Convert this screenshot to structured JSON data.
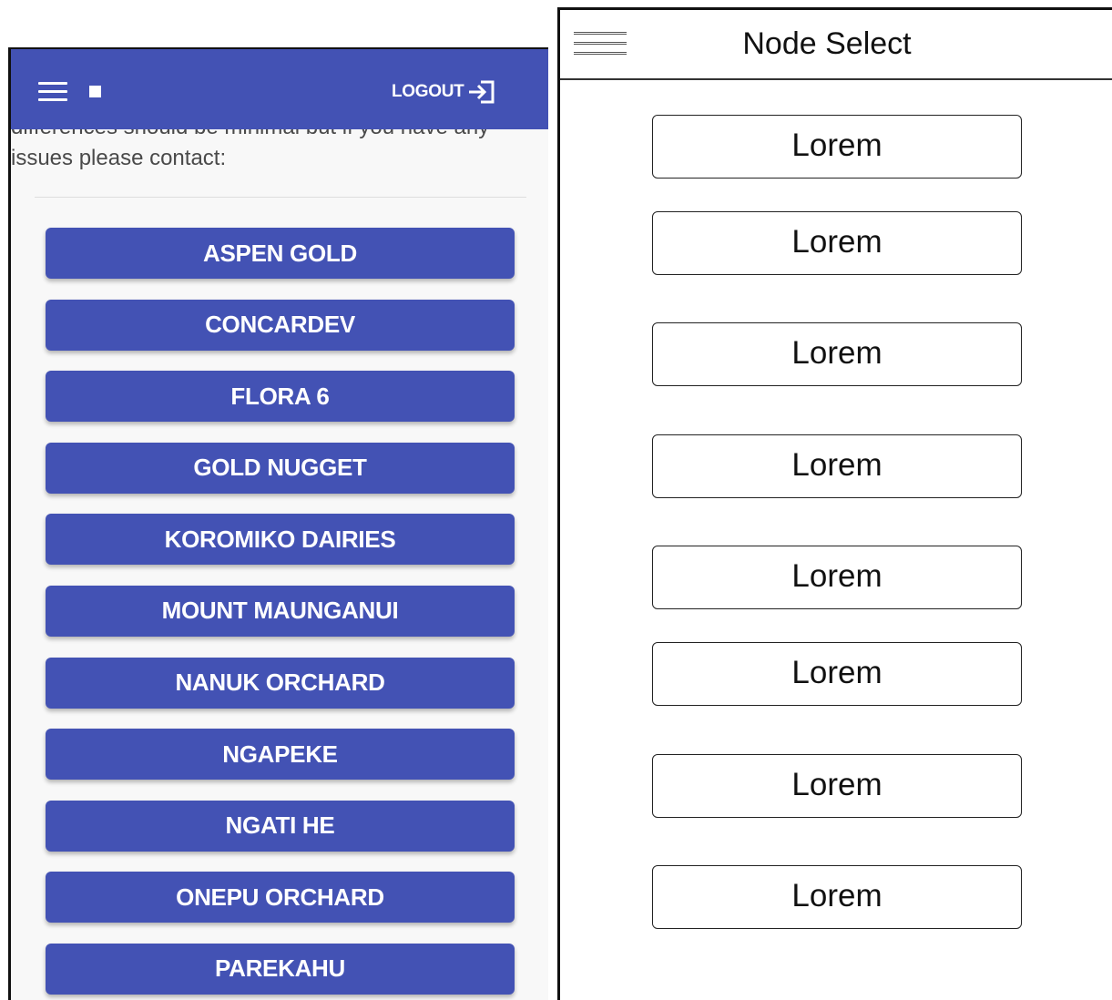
{
  "left": {
    "header": {
      "logout_label": "LOGOUT"
    },
    "cut_text": "differences should be minimal but if you have any",
    "contact_text": "issues please contact:",
    "farms": [
      "ASPEN GOLD",
      "CONCARDEV",
      "FLORA 6",
      "GOLD NUGGET",
      "KOROMIKO DAIRIES",
      "MOUNT MAUNGANUI",
      "NANUK ORCHARD",
      "NGAPEKE",
      "NGATI HE",
      "ONEPU ORCHARD",
      "PAREKAHU"
    ],
    "colors": {
      "brand": "#4352b4",
      "background": "#f8f8f8"
    }
  },
  "right": {
    "title": "Node Select",
    "buttons": [
      "Lorem",
      "Lorem",
      "Lorem",
      "Lorem",
      "Lorem",
      "Lorem",
      "Lorem",
      "Lorem"
    ]
  },
  "icons": {
    "menu": "hamburger-menu-icon",
    "square": "square-icon",
    "logout": "logout-arrow-icon"
  }
}
